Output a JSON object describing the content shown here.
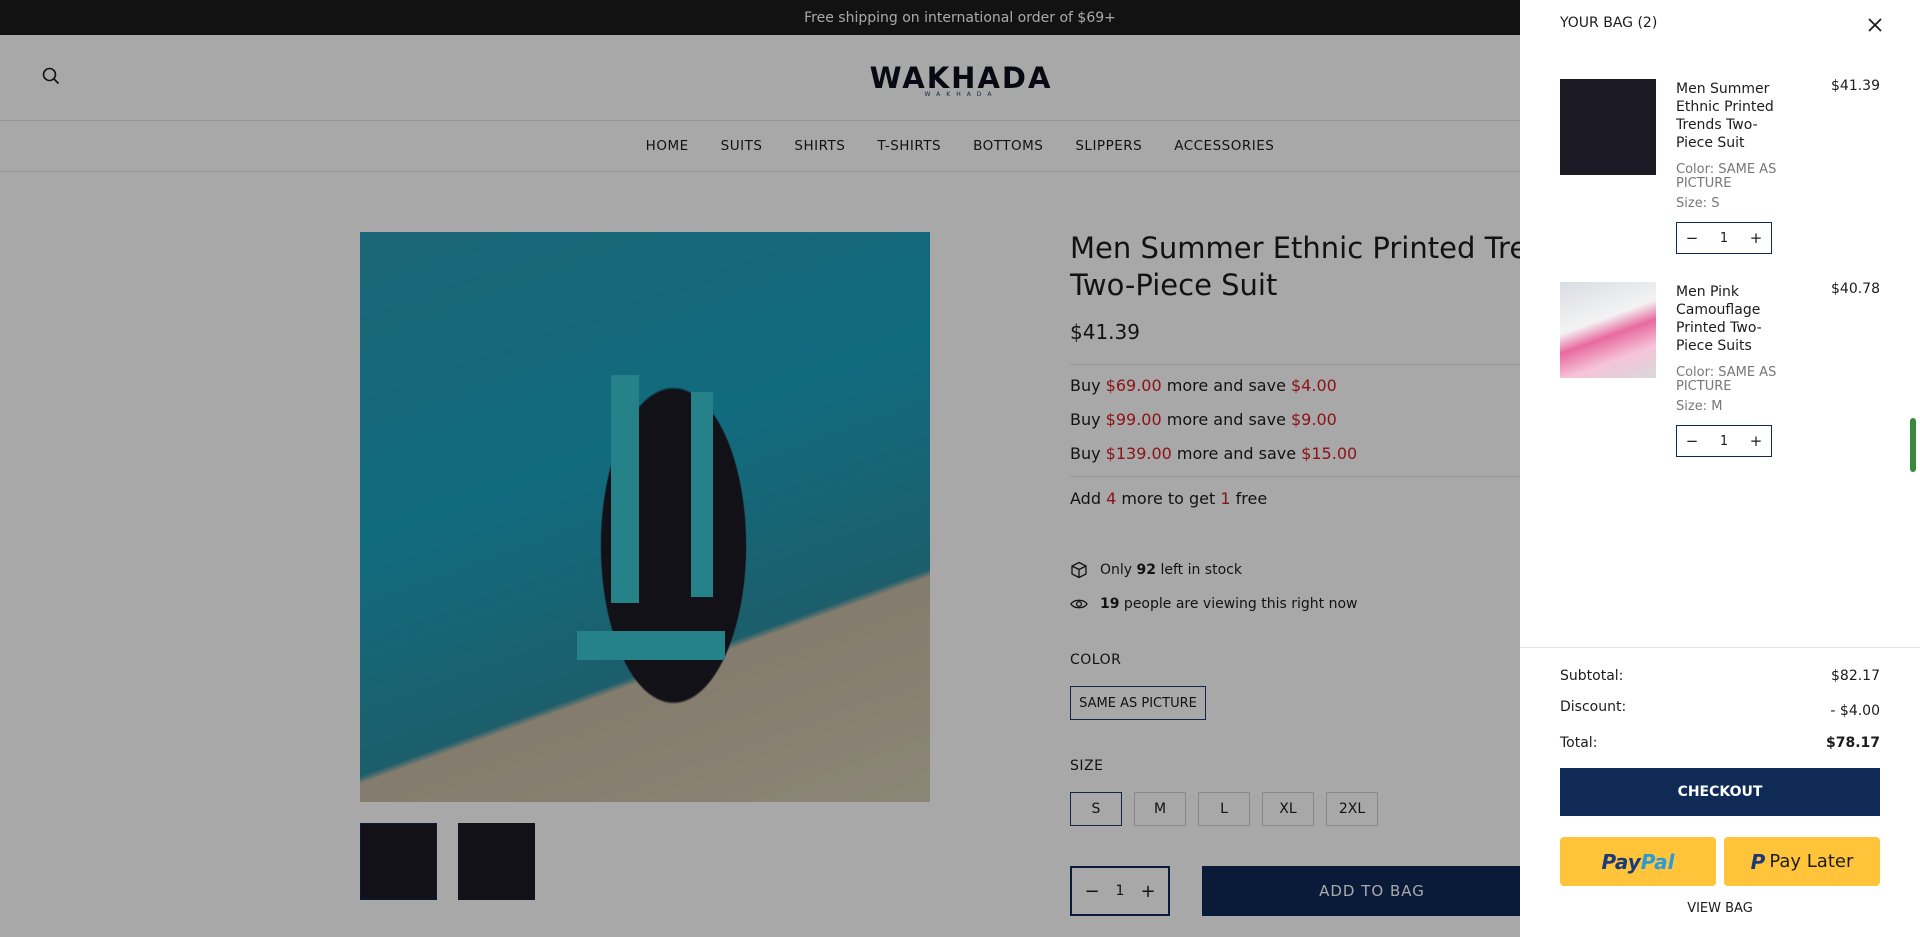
{
  "announcement": "Free shipping on international order of $69+",
  "brand": {
    "logo": "WAKHADA",
    "logo_sub": "WAKHADA"
  },
  "nav": [
    "HOME",
    "SUITS",
    "SHIRTS",
    "T-SHIRTS",
    "BOTTOMS",
    "SLIPPERS",
    "ACCESSORIES"
  ],
  "product": {
    "title_line1": "Men Summer Ethnic Printed Tre",
    "title_line2": "Two-Piece Suit",
    "price": "$41.39",
    "offers": [
      {
        "pre": "Buy ",
        "amount": "$69.00",
        "mid": " more and save ",
        "save": "$4.00"
      },
      {
        "pre": "Buy ",
        "amount": "$99.00",
        "mid": " more and save ",
        "save": "$9.00"
      },
      {
        "pre": "Buy ",
        "amount": "$139.00",
        "mid": " more and save ",
        "save": "$15.00"
      }
    ],
    "free_offer": {
      "pre": "Add ",
      "count": "4",
      "mid": " more to get ",
      "free": "1",
      "post": " free"
    },
    "stock": {
      "pre": "Only ",
      "count": "92",
      "post": " left in stock"
    },
    "viewing": {
      "count": "19",
      "post": " people are viewing this right now"
    },
    "color_label": "COLOR",
    "color_value": "SAME AS PICTURE",
    "size_label": "SIZE",
    "sizes": [
      "S",
      "M",
      "L",
      "XL",
      "2XL"
    ],
    "selected_size": "S",
    "qty": "1",
    "add_to_bag": "ADD TO BAG"
  },
  "cart": {
    "title": "YOUR BAG (2)",
    "items": [
      {
        "name": "Men Summer Ethnic Printed Trends Two-Piece Suit",
        "price": "$41.39",
        "color": "Color: SAME AS PICTURE",
        "size": "Size: S",
        "qty": "1"
      },
      {
        "name": "Men Pink Camouflage Printed Two-Piece Suits",
        "price": "$40.78",
        "color": "Color: SAME AS PICTURE",
        "size": "Size: M",
        "qty": "1"
      }
    ],
    "subtotal_label": "Subtotal:",
    "subtotal": "$82.17",
    "discount_label": "Discount:",
    "discount": "- $4.00",
    "total_label": "Total:",
    "total": "$78.17",
    "checkout": "CHECKOUT",
    "paypal": "PayPal",
    "paylater": "Pay Later",
    "view_bag": "VIEW BAG"
  },
  "colors": {
    "navy": "#0e2a55",
    "sale_red": "#d51d24",
    "paypal_yellow": "#ffc439"
  }
}
